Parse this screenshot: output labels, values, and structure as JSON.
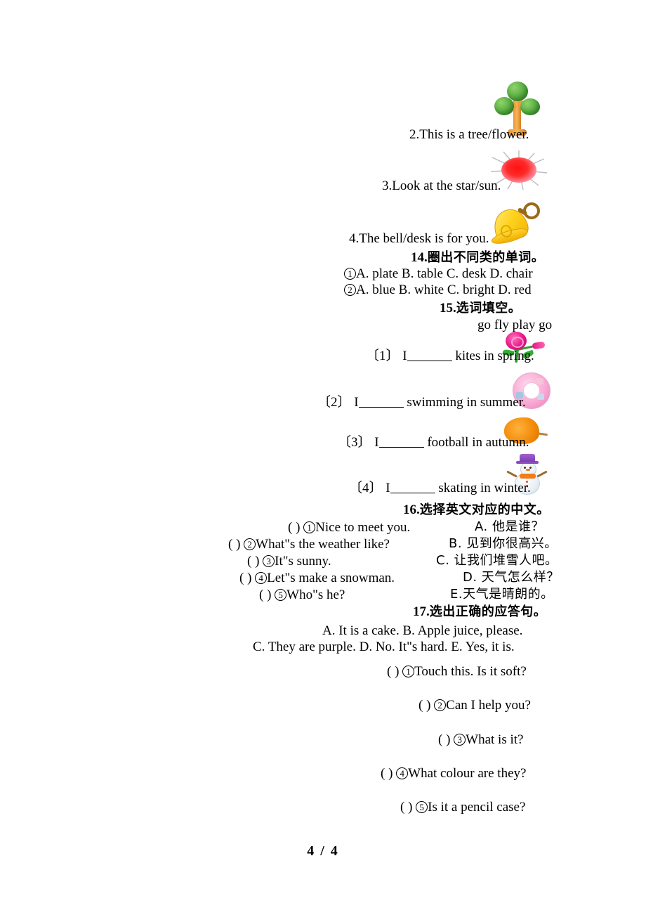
{
  "page": {
    "footer_label": "4 / 4"
  },
  "picture_sentences": [
    {
      "text": "2.This is a tree/flower.",
      "icon": "tree-icon"
    },
    {
      "text": "3.Look at the star/sun.",
      "icon": "sun-icon"
    },
    {
      "text": "4.The bell/desk is for you.",
      "icon": "bell-icon"
    }
  ],
  "section14": {
    "number": "14.",
    "heading_cn": "圈出不同类的单词。",
    "items": [
      {
        "marker": "1",
        "options": "A. plate   B. table   C. desk    D. chair"
      },
      {
        "marker": "2",
        "options": "A. blue   B. white   C. bright   D. red"
      }
    ]
  },
  "section15": {
    "number": "15.",
    "heading_cn": "选词填空。",
    "word_bank": "go fly play go",
    "items": [
      {
        "marker": "〔1〕",
        "pre": "I",
        "post": "kites in spring.",
        "icon": "rose-icon"
      },
      {
        "marker": "〔2〕",
        "pre": "I",
        "post": "swimming in summer.",
        "icon": "swim-ring-icon"
      },
      {
        "marker": "〔3〕",
        "pre": "I",
        "post": "football in autumn.",
        "icon": "autumn-leaf-icon"
      },
      {
        "marker": "〔4〕",
        "pre": "I",
        "post": "skating in winter.",
        "icon": "snowman-icon"
      }
    ]
  },
  "section16": {
    "number": "16.",
    "heading_cn": "选择英文对应的中文。",
    "questions": [
      {
        "paren": "(    )",
        "marker": "1",
        "text": "Nice to meet you."
      },
      {
        "paren": "(    )",
        "marker": "2",
        "text": "What\"s the weather like?"
      },
      {
        "paren": "(    )",
        "marker": "3",
        "text": "It\"s sunny."
      },
      {
        "paren": "(    )",
        "marker": "4",
        "text": "Let\"s make a snowman."
      },
      {
        "paren": "(    )",
        "marker": "5",
        "text": "Who\"s he?"
      }
    ],
    "answers": [
      "A. 他是谁？",
      "B. 见到你很高兴。",
      "C. 让我们堆雪人吧。",
      "D. 天气怎么样？",
      "E.天气是晴朗的。"
    ]
  },
  "section17": {
    "number": "17.",
    "heading_cn": "选出正确的应答句。",
    "choices_line1": "A. It is a cake.        B. Apple juice, please.",
    "choices_line2": "C. They are purple.     D. No. It\"s hard.        E. Yes, it is.",
    "questions": [
      {
        "paren": "(    )",
        "marker": "1",
        "text": "Touch this. Is it soft?"
      },
      {
        "paren": "(    )",
        "marker": "2",
        "text": "Can I help you?"
      },
      {
        "paren": "(    )",
        "marker": "3",
        "text": "What is it?"
      },
      {
        "paren": "(    )",
        "marker": "4",
        "text": "What colour are they?"
      },
      {
        "paren": "(    )",
        "marker": "5",
        "text": "Is it a pencil case?"
      }
    ]
  }
}
